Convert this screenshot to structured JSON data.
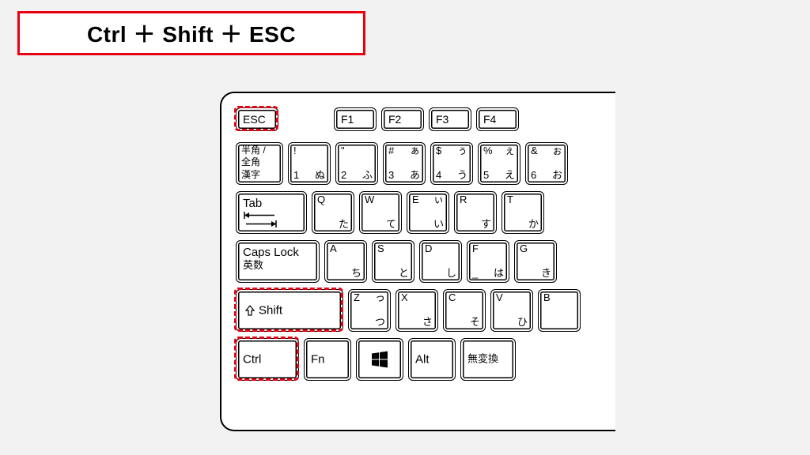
{
  "title": "Ctrl ＋ Shift ＋ ESC",
  "rows": {
    "fn": {
      "esc": "ESC",
      "f1": "F1",
      "f2": "F2",
      "f3": "F3",
      "f4": "F4"
    },
    "num": {
      "zenkaku": {
        "l1": "半角 /",
        "l2": "全角",
        "l3": "漢字"
      },
      "k1": {
        "tl": "!",
        "bl": "1",
        "tr": "",
        "br": "ぬ"
      },
      "k2": {
        "tl": "\"",
        "bl": "2",
        "tr": "",
        "br": "ふ"
      },
      "k3": {
        "tl": "#",
        "bl": "3",
        "tr": "ぁ",
        "br": "あ"
      },
      "k4": {
        "tl": "$",
        "bl": "4",
        "tr": "ぅ",
        "br": "う"
      },
      "k5": {
        "tl": "%",
        "bl": "5",
        "tr": "ぇ",
        "br": "え"
      },
      "k6": {
        "tl": "&",
        "bl": "6",
        "tr": "ぉ",
        "br": "お"
      }
    },
    "qwerty": {
      "tab": "Tab",
      "q": {
        "t": "Q",
        "b": "た"
      },
      "w": {
        "t": "W",
        "b": "て"
      },
      "e": {
        "t": "E",
        "b": "ぃ",
        "br": "い"
      },
      "r": {
        "t": "R",
        "b": "す"
      },
      "t": {
        "t": "T",
        "b": "か"
      }
    },
    "asdf": {
      "caps": {
        "l1": "Caps Lock",
        "l2": "英数"
      },
      "a": {
        "t": "A",
        "b": "ち"
      },
      "s": {
        "t": "S",
        "b": "と"
      },
      "d": {
        "t": "D",
        "b": "し"
      },
      "f": {
        "t": "F",
        "b": "",
        "br": "は",
        "tr": "_"
      },
      "g": {
        "t": "G",
        "b": "き"
      }
    },
    "zxcv": {
      "shift": "Shift",
      "z": {
        "t": "Z",
        "b": "",
        "br": "つ",
        "tr": "っ"
      },
      "x": {
        "t": "X",
        "b": "さ"
      },
      "c": {
        "t": "C",
        "b": "そ"
      },
      "v": {
        "t": "V",
        "b": "ひ"
      },
      "b": {
        "t": "B",
        "b": ""
      }
    },
    "bottom": {
      "ctrl": "Ctrl",
      "fn": "Fn",
      "alt": "Alt",
      "muhenkan": "無変換"
    }
  }
}
